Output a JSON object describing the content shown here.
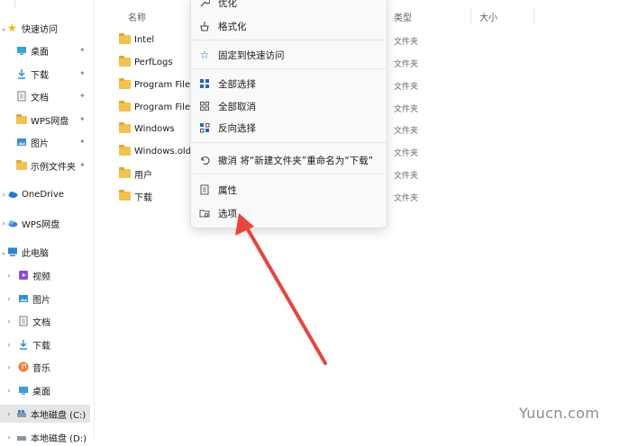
{
  "sidebar": {
    "quick_access": "快速访问",
    "quick_items": [
      {
        "label": "桌面",
        "icon": "desktop-icon"
      },
      {
        "label": "下载",
        "icon": "download-icon"
      },
      {
        "label": "文档",
        "icon": "document-icon"
      },
      {
        "label": "WPS网盘",
        "icon": "folder-icon"
      },
      {
        "label": "图片",
        "icon": "picture-icon"
      },
      {
        "label": "示例文件夹",
        "icon": "folder-icon"
      }
    ],
    "onedrive": "OneDrive",
    "wps_drive": "WPS网盘",
    "this_pc": "此电脑",
    "pc_items": [
      {
        "label": "视频",
        "icon": "video-icon"
      },
      {
        "label": "图片",
        "icon": "picture-icon"
      },
      {
        "label": "文档",
        "icon": "document-icon"
      },
      {
        "label": "下载",
        "icon": "download-icon"
      },
      {
        "label": "音乐",
        "icon": "music-icon"
      },
      {
        "label": "桌面",
        "icon": "desktop-icon"
      },
      {
        "label": "本地磁盘 (C:)",
        "icon": "drive-icon"
      },
      {
        "label": "本地磁盘 (D:)",
        "icon": "drive-icon"
      }
    ]
  },
  "columns": {
    "name": "名称",
    "type": "类型",
    "size": "大小"
  },
  "files": [
    {
      "name": "Intel",
      "type": "文件夹"
    },
    {
      "name": "PerfLogs",
      "type": "文件夹"
    },
    {
      "name": "Program Files",
      "type": "文件夹"
    },
    {
      "name": "Program Files",
      "type": "文件夹"
    },
    {
      "name": "Windows",
      "type": "文件夹"
    },
    {
      "name": "Windows.old",
      "type": "文件夹"
    },
    {
      "name": "用户",
      "type": "文件夹"
    },
    {
      "name": "下载",
      "type": "文件夹"
    }
  ],
  "menu": {
    "optimize": "优化",
    "format": "格式化",
    "pin_quick": "固定到快速访问",
    "select_all": "全部选择",
    "select_none": "全部取消",
    "invert": "反向选择",
    "undo": "撤消 将“新建文件夹”重命名为“下载”",
    "properties": "属性",
    "options": "选项"
  },
  "colors": {
    "accent": "#2463c6",
    "arrow": "#e8453c",
    "folder": "#f2c14e"
  },
  "watermark": "Yuucn.com"
}
